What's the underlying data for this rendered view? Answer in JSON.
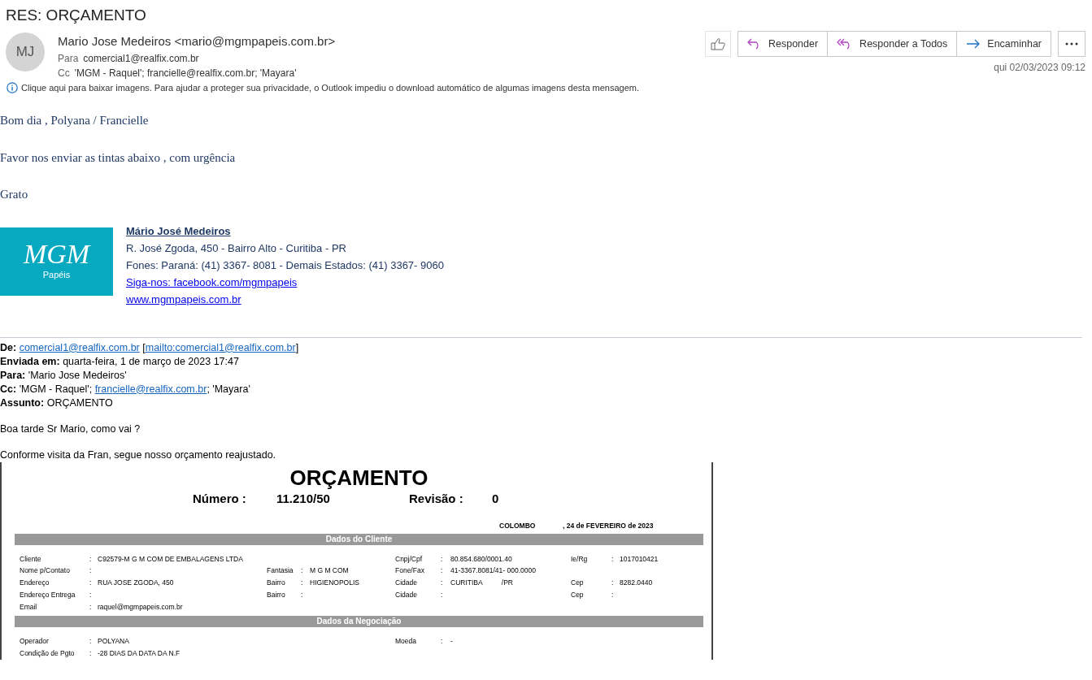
{
  "subject": "RES: ORÇAMENTO",
  "sender": {
    "initials": "MJ",
    "name": "Mario Jose Medeiros <mario@mgmpapeis.com.br>"
  },
  "recipients": [
    {
      "label": "Para",
      "value": "comercial1@realfix.com.br"
    },
    {
      "label": "Cc",
      "value": "'MGM - Raquel'; francielle@realfix.com.br; 'Mayara'"
    }
  ],
  "actions": [
    {
      "kind": "reply",
      "label": "Responder"
    },
    {
      "kind": "reply_all",
      "label": "Responder a Todos"
    },
    {
      "kind": "forward",
      "label": "Encaminhar"
    }
  ],
  "date": "qui 02/03/2023 09:12",
  "info_bar": "Clique aqui para baixar imagens. Para ajudar a proteger sua privacidade, o Outlook impediu o download automático de algumas imagens desta mensagem.",
  "body": [
    "Bom dia , Polyana / Francielle",
    "Favor nos enviar as tintas abaixo , com urgência",
    "Grato"
  ],
  "signature": {
    "logo_text": "MGM",
    "logo_subtext": "Papéis",
    "name": "Mário José Medeiros",
    "address": "R. José Zgoda, 450 - Bairro Alto - Curitiba - PR",
    "phones": "Fones: Paraná: (41) 3367- 8081 - Demais Estados: (41) 3367- 9060",
    "links": [
      "Siga-nos: facebook.com/mgmpapeis",
      "www.mgmpapeis.com.br"
    ]
  },
  "quoted_header": [
    {
      "label": "De:",
      "parts": [
        {
          "text": "comercial1@realfix.com.br",
          "link": true
        },
        {
          "text": " [",
          "link": false
        },
        {
          "text": "mailto:comercial1@realfix.com.br",
          "link": true
        },
        {
          "text": "]",
          "link": false
        }
      ]
    },
    {
      "label": "Enviada em:",
      "parts": [
        {
          "text": "quarta-feira, 1 de março de 2023 17:47",
          "link": false
        }
      ]
    },
    {
      "label": "Para:",
      "parts": [
        {
          "text": "'Mario Jose Medeiros'",
          "link": false
        }
      ]
    },
    {
      "label": "Cc:",
      "parts": [
        {
          "text": "'MGM - Raquel'; ",
          "link": false
        },
        {
          "text": "francielle@realfix.com.br",
          "link": true
        },
        {
          "text": "; 'Mayara'",
          "link": false
        }
      ]
    },
    {
      "label": "Assunto:",
      "parts": [
        {
          "text": "ORÇAMENTO",
          "link": false
        }
      ]
    }
  ],
  "quoted_body": [
    "Boa tarde Sr Mario, como vai ?",
    "Conforme visita da Fran, segue nosso orçamento reajustado."
  ],
  "document": {
    "title": "ORÇAMENTO",
    "number_label": "Número :",
    "number": "11.210/50",
    "revision_label": "Revisão :",
    "revision": "0",
    "city": "COLOMBO",
    "date": ", 24 de FEVEREIRO  de 2023",
    "sections": [
      {
        "title": "Dados do Cliente",
        "rows": [
          [
            {
              "label": "Cliente",
              "sep": ":",
              "value": "C92579-M G M COM DE EMBALAGENS LTDA"
            },
            null,
            {
              "label": "Cnpj/Cpf",
              "sep": ":",
              "value": "80.854.680/0001.40"
            },
            {
              "label": "Ie/Rg",
              "sep": ":",
              "value": "1017010421"
            }
          ],
          [
            {
              "label": "Nome p/Contato",
              "sep": ":"
            },
            {
              "label": "Fantasia",
              "sep": ":",
              "value": "M G M COM"
            },
            {
              "label": "Fone/Fax",
              "sep": ":",
              "value": "41-3367.8081/41- 000.0000"
            },
            null
          ],
          [
            {
              "label": "Endereço",
              "sep": ":",
              "value": "RUA JOSE ZGODA, 450"
            },
            {
              "label": "Bairro",
              "sep": ":",
              "value": "HIGIENOPOLIS"
            },
            {
              "label": "Cidade",
              "sep": ":",
              "value": "CURITIBA          /PR"
            },
            {
              "label": "Cep",
              "sep": ":",
              "value": "8282.0440"
            }
          ],
          [
            {
              "label": "Endereço Entrega",
              "sep": ":"
            },
            {
              "label": "Bairro",
              "sep": ":"
            },
            {
              "label": "Cidade",
              "sep": ":"
            },
            {
              "label": "Cep",
              "sep": ":"
            }
          ],
          [
            {
              "label": "Email",
              "sep": ":",
              "value": "raquel@mgmpapeis.com.br"
            },
            null,
            null,
            null
          ]
        ]
      },
      {
        "title": "Dados da Negociação",
        "rows": [
          [
            {
              "label": "Operador",
              "sep": ":",
              "value": "POLYANA"
            },
            null,
            {
              "label": "Moeda",
              "sep": ":",
              "value": "-"
            },
            null
          ],
          [
            {
              "label": "Condição de Pgto",
              "sep": ":",
              "value": "-28 DIAS DA DATA DA N.F"
            },
            null,
            null,
            null
          ]
        ]
      }
    ]
  }
}
